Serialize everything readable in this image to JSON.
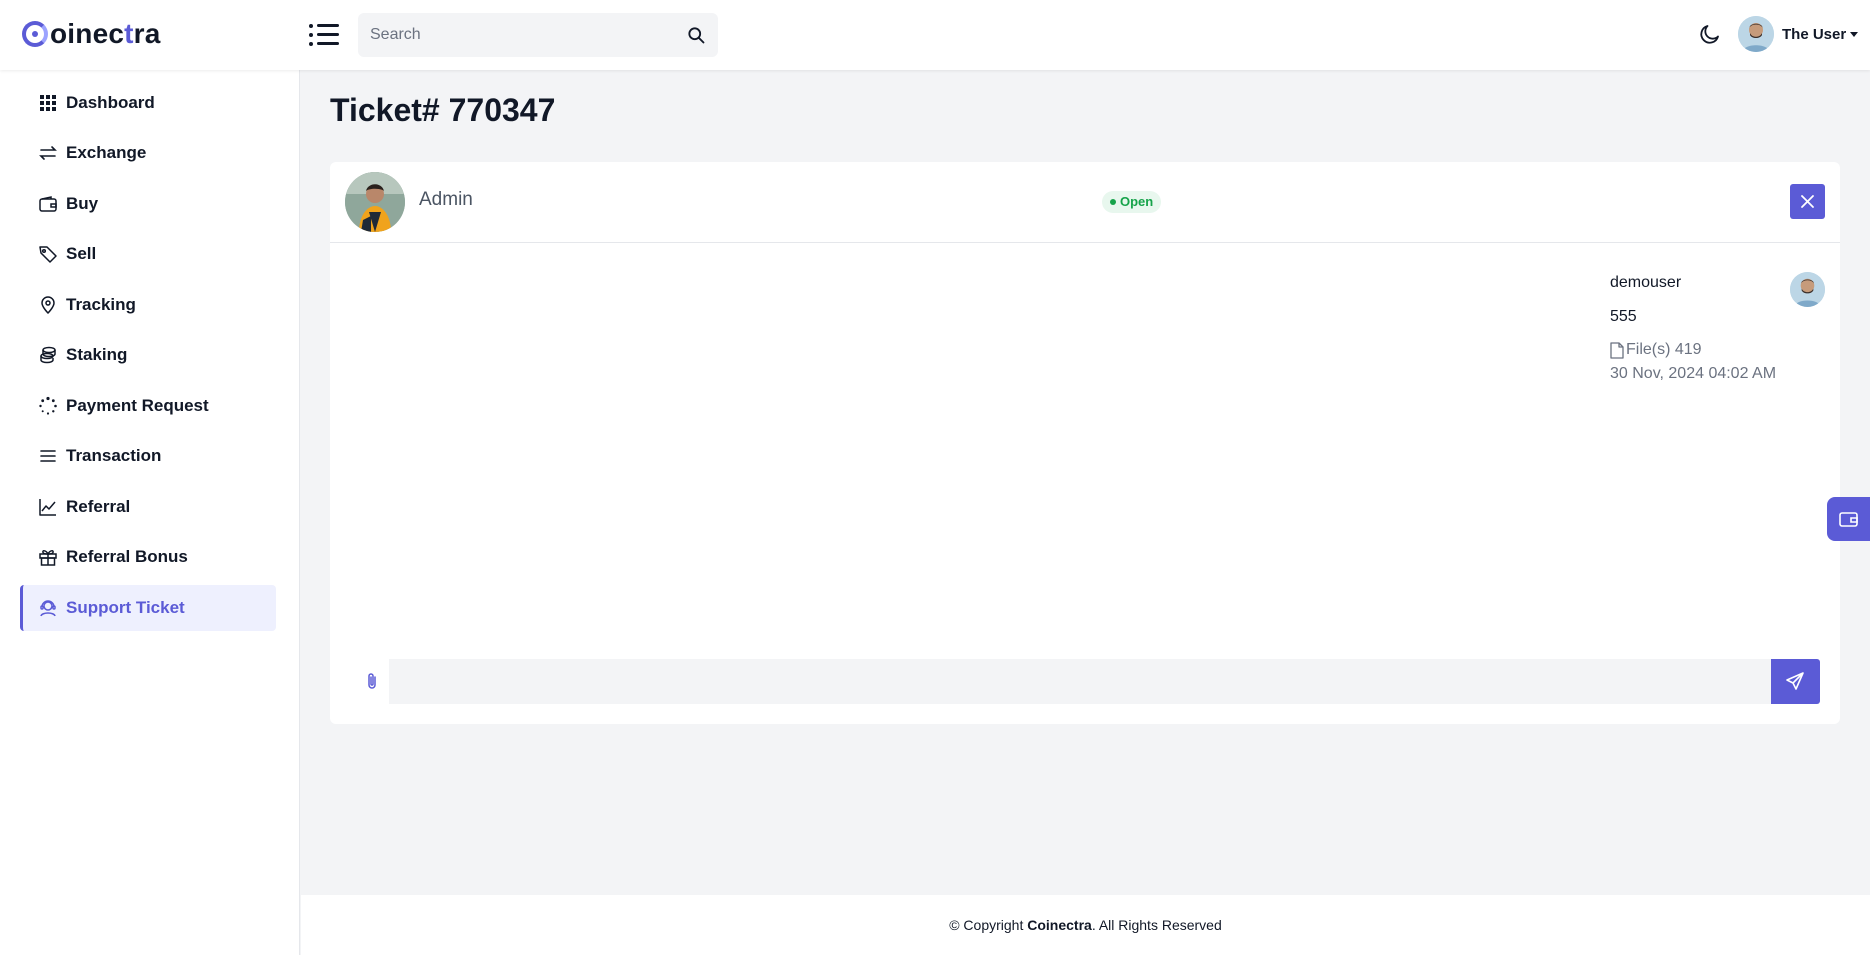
{
  "brand": {
    "name_start": "oinec",
    "name_accent": "t",
    "name_end": "ra"
  },
  "search": {
    "placeholder": "Search"
  },
  "user": {
    "name": "The User"
  },
  "sidebar": {
    "items": [
      {
        "label": "Dashboard",
        "icon": "grid-icon"
      },
      {
        "label": "Exchange",
        "icon": "swap-icon"
      },
      {
        "label": "Buy",
        "icon": "wallet-icon"
      },
      {
        "label": "Sell",
        "icon": "tag-icon"
      },
      {
        "label": "Tracking",
        "icon": "location-pin-icon"
      },
      {
        "label": "Staking",
        "icon": "coins-icon"
      },
      {
        "label": "Payment Request",
        "icon": "spinner-icon"
      },
      {
        "label": "Transaction",
        "icon": "list-icon"
      },
      {
        "label": "Referral",
        "icon": "chart-line-icon"
      },
      {
        "label": "Referral Bonus",
        "icon": "gift-icon"
      },
      {
        "label": "Support Ticket",
        "icon": "support-agent-icon",
        "active": true
      }
    ]
  },
  "page": {
    "title": "Ticket# 770347"
  },
  "ticket": {
    "assignee": "Admin",
    "status": "Open",
    "messages": [
      {
        "user": "demouser",
        "text": "555",
        "file_label": "File(s) 419",
        "time": "30 Nov, 2024 04:02 AM"
      }
    ],
    "reply_placeholder": ""
  },
  "footer": {
    "prefix": "© Copyright ",
    "brand": "Coinectra",
    "suffix": ". All Rights Reserved"
  },
  "colors": {
    "accent": "#5b5bd6",
    "status_open": "#16a34a"
  }
}
